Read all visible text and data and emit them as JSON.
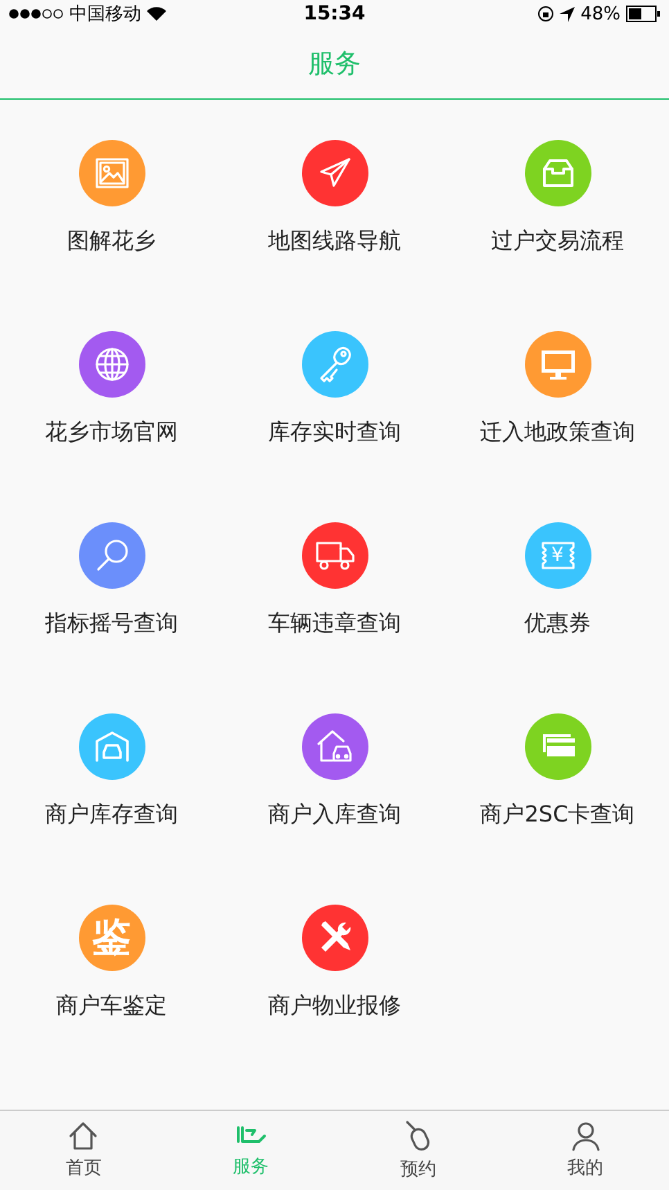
{
  "status_bar": {
    "carrier": "中国移动",
    "time": "15:34",
    "battery": "48%"
  },
  "nav": {
    "title": "服务"
  },
  "services": [
    {
      "label": "图解花乡",
      "kind": "picture-frame",
      "color": "#ff9a33"
    },
    {
      "label": "地图线路导航",
      "kind": "paper-plane",
      "color": "#ff3333"
    },
    {
      "label": "过户交易流程",
      "kind": "tray",
      "color": "#7ed321"
    },
    {
      "label": "花乡市场官网",
      "kind": "globe",
      "color": "#a35af0"
    },
    {
      "label": "库存实时查询",
      "kind": "key",
      "color": "#3ac4fd"
    },
    {
      "label": "迁入地政策查询",
      "kind": "monitor",
      "color": "#ff9a33"
    },
    {
      "label": "指标摇号查询",
      "kind": "magnifier",
      "color": "#6b8ffb"
    },
    {
      "label": "车辆违章查询",
      "kind": "truck",
      "color": "#ff3333"
    },
    {
      "label": "优惠券",
      "kind": "coupon",
      "color": "#3ac4fd",
      "glyph": "¥"
    },
    {
      "label": "商户库存查询",
      "kind": "garage",
      "color": "#3ac4fd"
    },
    {
      "label": "商户入库查询",
      "kind": "house-car",
      "color": "#a35af0"
    },
    {
      "label": "商户2SC卡查询",
      "kind": "cards",
      "color": "#7ed321"
    },
    {
      "label": "商户车鉴定",
      "kind": "glyph",
      "color": "#ff9a33",
      "glyph": "鉴"
    },
    {
      "label": "商户物业报修",
      "kind": "tools",
      "color": "#ff3333"
    }
  ],
  "tabs": [
    {
      "label": "首页",
      "kind": "home",
      "selected": false
    },
    {
      "label": "服务",
      "kind": "service",
      "selected": true
    },
    {
      "label": "预约",
      "kind": "mouse",
      "selected": false
    },
    {
      "label": "我的",
      "kind": "person",
      "selected": false
    }
  ]
}
